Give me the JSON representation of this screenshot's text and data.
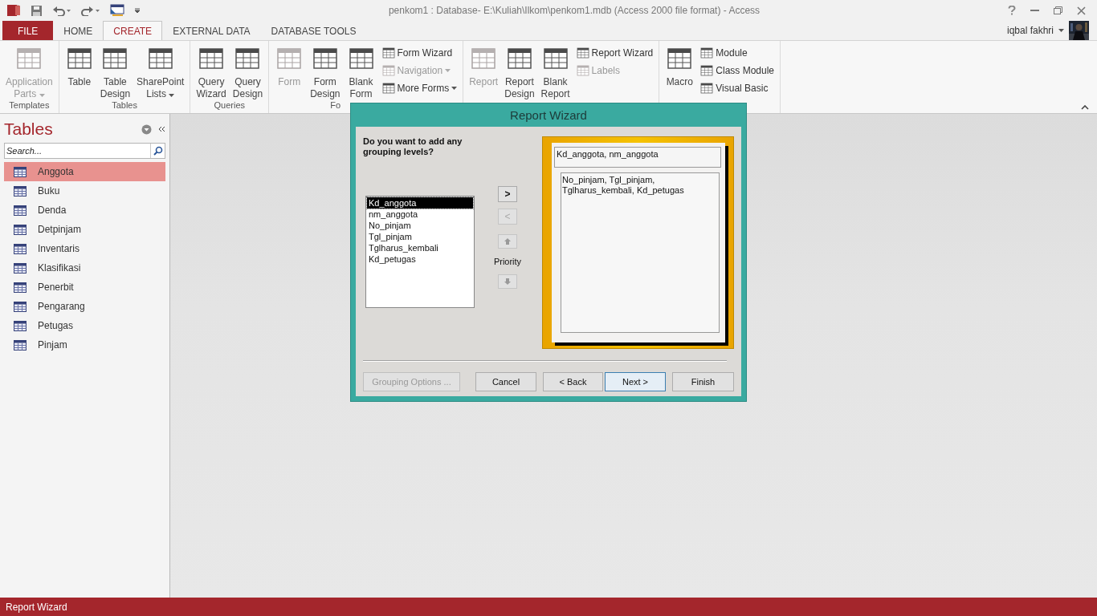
{
  "window": {
    "title": "penkom1 : Database- E:\\Kuliah\\Ilkom\\penkom1.mdb (Access 2000 file format) - Access",
    "user": "iqbal fakhri"
  },
  "tabs": [
    {
      "label": "FILE",
      "kind": "file",
      "selected": false
    },
    {
      "label": "HOME",
      "kind": "tab",
      "selected": false
    },
    {
      "label": "CREATE",
      "kind": "tab",
      "selected": true
    },
    {
      "label": "EXTERNAL DATA",
      "kind": "tab",
      "selected": false
    },
    {
      "label": "DATABASE TOOLS",
      "kind": "tab",
      "selected": false
    }
  ],
  "ribbon": [
    {
      "label": "Templates",
      "items": [
        {
          "kind": "large",
          "lines": [
            "Application",
            "Parts"
          ],
          "disabled": true,
          "menu": true
        }
      ]
    },
    {
      "label": "Tables",
      "items": [
        {
          "kind": "large",
          "lines": [
            "Table"
          ],
          "disabled": false,
          "menu": false
        },
        {
          "kind": "large",
          "lines": [
            "Table",
            "Design"
          ],
          "disabled": false,
          "menu": false
        },
        {
          "kind": "large",
          "lines": [
            "SharePoint",
            "Lists"
          ],
          "disabled": false,
          "menu": true
        }
      ]
    },
    {
      "label": "Queries",
      "items": [
        {
          "kind": "large",
          "lines": [
            "Query",
            "Wizard"
          ],
          "disabled": false,
          "menu": false
        },
        {
          "kind": "large",
          "lines": [
            "Query",
            "Design"
          ],
          "disabled": false,
          "menu": false
        }
      ]
    },
    {
      "label": "Fo",
      "items": [
        {
          "kind": "large",
          "lines": [
            "Form"
          ],
          "disabled": true,
          "menu": false
        },
        {
          "kind": "large",
          "lines": [
            "Form",
            "Design"
          ],
          "disabled": false,
          "menu": false
        },
        {
          "kind": "large",
          "lines": [
            "Blank",
            "Form"
          ],
          "disabled": false,
          "menu": false
        },
        {
          "kind": "small",
          "label": "Form Wizard",
          "disabled": false,
          "menu": false
        },
        {
          "kind": "small",
          "label": "Navigation",
          "disabled": true,
          "menu": true
        },
        {
          "kind": "small",
          "label": "More Forms",
          "disabled": false,
          "menu": true
        }
      ]
    },
    {
      "items": [
        {
          "kind": "large",
          "lines": [
            "Report"
          ],
          "disabled": true,
          "menu": false
        },
        {
          "kind": "large",
          "lines": [
            "Report",
            "Design"
          ],
          "disabled": false,
          "menu": false
        },
        {
          "kind": "large",
          "lines": [
            "Blank",
            "Report"
          ],
          "disabled": false,
          "menu": false
        },
        {
          "kind": "small",
          "label": "Report Wizard",
          "disabled": false,
          "menu": false
        },
        {
          "kind": "small",
          "label": "Labels",
          "disabled": true,
          "menu": false
        }
      ]
    },
    {
      "items": [
        {
          "kind": "large",
          "lines": [
            "Macro"
          ],
          "disabled": false,
          "menu": false
        },
        {
          "kind": "small",
          "label": "Module",
          "disabled": false,
          "menu": false
        },
        {
          "kind": "small",
          "label": "Class Module",
          "disabled": false,
          "menu": false
        },
        {
          "kind": "small",
          "label": "Visual Basic",
          "disabled": false,
          "menu": false
        }
      ]
    }
  ],
  "nav_pane": {
    "title": "Tables",
    "search": {
      "placeholder": "Search..."
    },
    "items": [
      {
        "label": "Anggota",
        "selected": true
      },
      {
        "label": "Buku",
        "selected": false
      },
      {
        "label": "Denda",
        "selected": false
      },
      {
        "label": "Detpinjam",
        "selected": false
      },
      {
        "label": "Inventaris",
        "selected": false
      },
      {
        "label": "Klasifikasi",
        "selected": false
      },
      {
        "label": "Penerbit",
        "selected": false
      },
      {
        "label": "Pengarang",
        "selected": false
      },
      {
        "label": "Petugas",
        "selected": false
      },
      {
        "label": "Pinjam",
        "selected": false
      }
    ]
  },
  "dialog": {
    "title": "Report Wizard",
    "prompt": "Do you want to add any grouping levels?",
    "fields": [
      {
        "label": "Kd_anggota",
        "selected": true
      },
      {
        "label": "nm_anggota",
        "selected": false
      },
      {
        "label": "No_pinjam",
        "selected": false
      },
      {
        "label": "Tgl_pinjam",
        "selected": false
      },
      {
        "label": "Tglharus_kembali",
        "selected": false
      },
      {
        "label": "Kd_petugas",
        "selected": false
      }
    ],
    "move_buttons": [
      {
        "label": ">",
        "disabled": false
      },
      {
        "label": "<",
        "disabled": true
      }
    ],
    "priority_label": "Priority",
    "preview": {
      "group_header": "Kd_anggota, nm_anggota",
      "detail_lines": [
        "No_pinjam, Tgl_pinjam,",
        "Tglharus_kembali, Kd_petugas"
      ]
    },
    "buttons": [
      {
        "label": "Grouping Options ...",
        "disabled": true,
        "default": false
      },
      {
        "label": "Cancel",
        "disabled": false,
        "default": false
      },
      {
        "label": "< Back",
        "disabled": false,
        "default": false
      },
      {
        "label": "Next >",
        "disabled": false,
        "default": true
      },
      {
        "label": "Finish",
        "disabled": false,
        "default": false
      }
    ]
  },
  "status_bar": "Report Wizard"
}
